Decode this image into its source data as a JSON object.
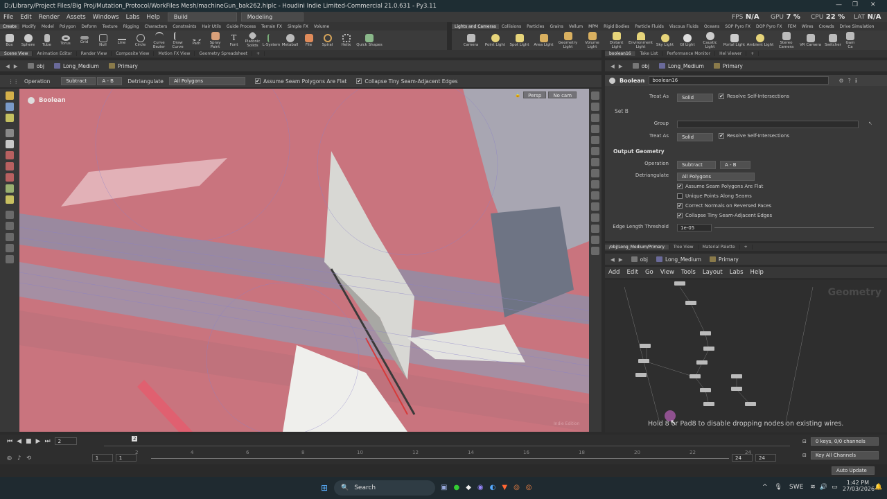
{
  "window": {
    "title": "D:/Library/Project Files/Big Proj/Mutation_Protocol/WorkFiles Mesh/machineGun_bak262.hiplc - Houdini Indie Limited-Commercial 21.0.631 - Py3.11"
  },
  "menu": [
    "File",
    "Edit",
    "Render",
    "Assets",
    "Windows",
    "Labs",
    "Help"
  ],
  "desktops": [
    "Build",
    "Modeling"
  ],
  "stats": {
    "fps_label": "FPS",
    "fps": "N/A",
    "gpu_label": "GPU",
    "gpu": "7 %",
    "cpu_label": "CPU",
    "cpu": "22 %",
    "lat_label": "LAT",
    "lat": "N/A"
  },
  "shelf_tabs_left": [
    "Create",
    "Modify",
    "Model",
    "Polygon",
    "Deform",
    "Texture",
    "Rigging",
    "Characters",
    "Constraints",
    "Hair Utils",
    "Guide Process",
    "Terrain FX",
    "Simple FX",
    "Volume"
  ],
  "shelf_tabs_right": [
    "Lights and Cameras",
    "Collisions",
    "Particles",
    "Grains",
    "Vellum",
    "MPM",
    "Rigid Bodies",
    "Particle Fluids",
    "Viscous Fluids",
    "Oceans",
    "SOP Pyro FX",
    "DOP Pyro FX",
    "FEM",
    "Wires",
    "Crowds",
    "Drive Simulation"
  ],
  "tools_left": [
    "Box",
    "Sphere",
    "Tube",
    "Torus",
    "Grid",
    "Null",
    "Line",
    "Circle",
    "Curve Bezier",
    "Draw Curve",
    "Path",
    "Spray Paint",
    "Font",
    "Platonic Solids",
    "L-System",
    "Metaball",
    "File",
    "Spiral",
    "Helix",
    "Quick Shapes"
  ],
  "tools_right": [
    "Camera",
    "Point Light",
    "Spot Light",
    "Area Light",
    "Geometry Light",
    "Volume Light",
    "Distant Light",
    "Environment Light",
    "Sky Light",
    "GI Light",
    "Caustic Light",
    "Portal Light",
    "Ambient Light",
    "Stereo Camera",
    "VR Camera",
    "Switcher",
    "Gam Ca"
  ],
  "pane_tabs_left": [
    "Scene View",
    "Animation Editor",
    "Render View",
    "Composite View",
    "Motion FX View",
    "Geometry Spreadsheet"
  ],
  "pane_tabs_right_top": [
    "boolean16",
    "Take List",
    "Performance Monitor",
    "Hel Viewer"
  ],
  "path": {
    "obj": "obj",
    "geo": "Long_Medium",
    "sop": "Primary"
  },
  "viewport_opbar": {
    "operation_label": "Operation",
    "operation": "Subtract",
    "ab": "A - B",
    "detri_label": "Detriangulate",
    "detri": "All Polygons",
    "assume": "Assume Seam Polygons Are Flat",
    "collapse": "Collapse Tiny Seam-Adjacent Edges"
  },
  "viewport": {
    "node_label": "Boolean",
    "persp": "Persp",
    "cam": "No cam",
    "watermark": "Indie Edition"
  },
  "params": {
    "node_type": "Boolean",
    "node_name": "boolean16",
    "treat_as_label": "Treat As",
    "treat_as": "Solid",
    "resolve": "Resolve Self-Intersections",
    "set_b": "Set B",
    "group_label": "Group",
    "output_geometry": "Output Geometry",
    "operation_label": "Operation",
    "operation": "Subtract",
    "ab": "A - B",
    "detri_label": "Detriangulate",
    "detri": "All Polygons",
    "opt1": "Assume Seam Polygons Are Flat",
    "opt2": "Unique Points Along Seams",
    "opt3": "Correct Normals on Reversed Faces",
    "opt4": "Collapse Tiny Seam-Adjacent Edges",
    "edge_label": "Edge Length Threshold",
    "edge_value": "1e-05"
  },
  "pane_tabs_right_bottom": [
    "/obj/Long_Medium/Primary",
    "Tree View",
    "Material Palette"
  ],
  "net_menu": [
    "Add",
    "Edit",
    "Go",
    "View",
    "Tools",
    "Layout",
    "Labs",
    "Help"
  ],
  "net_context": "Geometry",
  "net_hint": "Hold 8 or Pad8 to disable dropping nodes on existing wires.",
  "timeline": {
    "frame": "2",
    "start": "1",
    "start2": "1",
    "end": "24",
    "end2": "24",
    "ticks": [
      "2",
      "4",
      "6",
      "8",
      "10",
      "12",
      "14",
      "16",
      "18",
      "20",
      "22",
      "24"
    ],
    "keys": "0 keys, 0/0 channels",
    "key_all": "Key All Channels",
    "auto_update": "Auto Update"
  },
  "taskbar": {
    "search": "Search",
    "lang": "SWE",
    "time": "1:42 PM",
    "date": "27/03/2026"
  }
}
